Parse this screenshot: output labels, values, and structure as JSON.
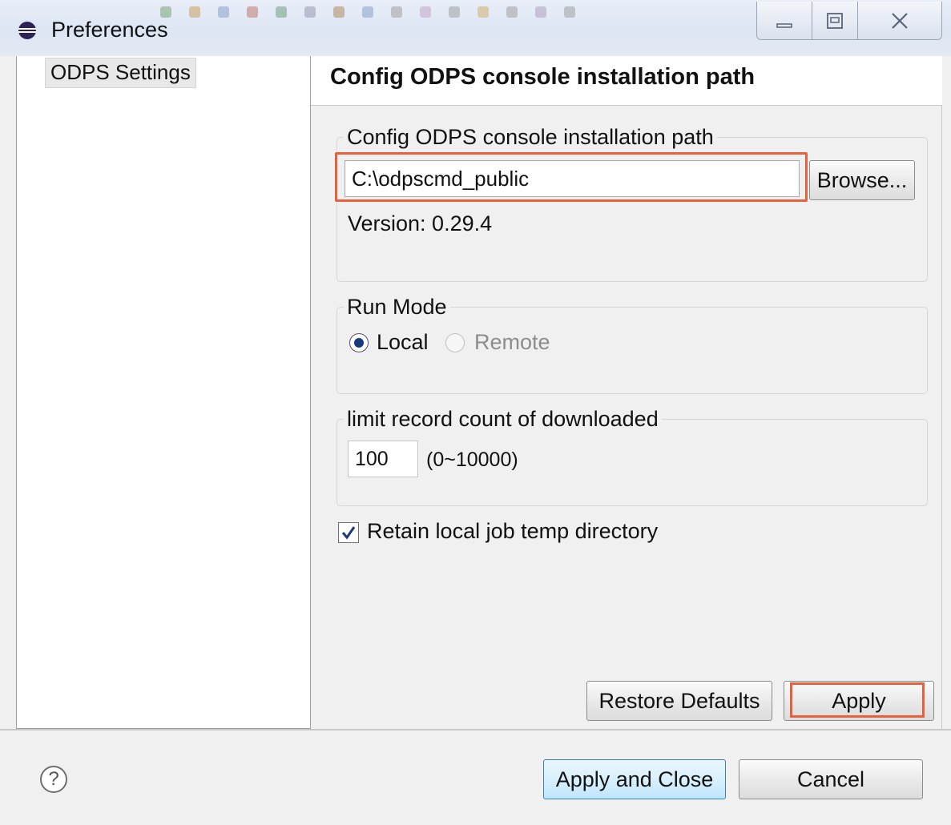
{
  "window": {
    "title": "Preferences"
  },
  "sidebar": {
    "items": [
      {
        "label": "ODPS Settings",
        "selected": true
      }
    ]
  },
  "page": {
    "title": "Config ODPS console installation path",
    "console_group": {
      "legend": "Config ODPS console installation path",
      "path_value": "C:\\odpscmd_public",
      "browse_label": "Browse...",
      "version_text": "Version: 0.29.4"
    },
    "run_mode": {
      "legend": "Run Mode",
      "options": [
        {
          "label": "Local",
          "selected": true,
          "enabled": true
        },
        {
          "label": "Remote",
          "selected": false,
          "enabled": false
        }
      ]
    },
    "limit": {
      "legend": "limit record count of downloaded",
      "value": "100",
      "range": "(0~10000)"
    },
    "retain_temp": {
      "label": "Retain local job temp directory",
      "checked": true
    },
    "buttons": {
      "restore_defaults": "Restore Defaults",
      "apply": "Apply"
    }
  },
  "footer": {
    "help_glyph": "?",
    "apply_and_close": "Apply and Close",
    "cancel": "Cancel"
  },
  "colors": {
    "highlight": "#e8603c",
    "accent_button": "#bee6fd"
  }
}
